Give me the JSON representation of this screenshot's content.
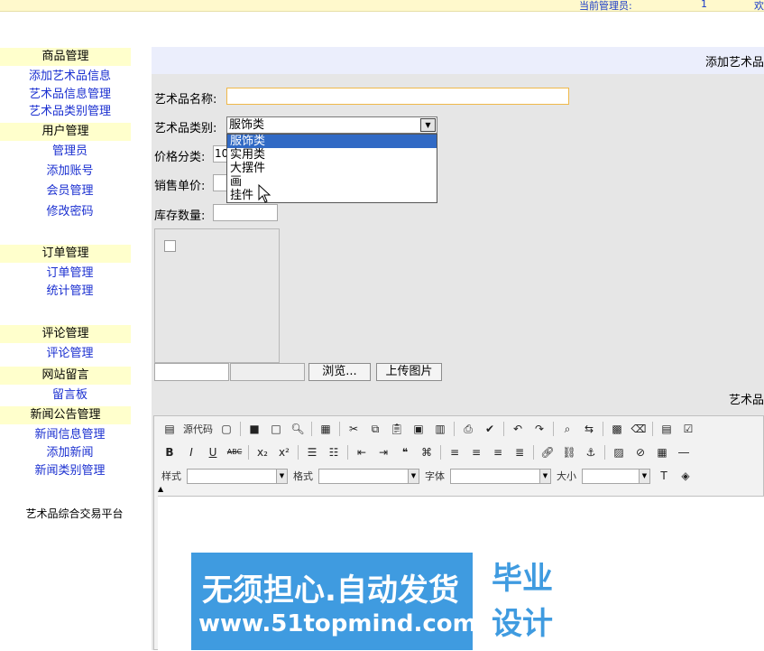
{
  "topbar": {
    "admin_label": "当前管理员:",
    "admin_count": "1",
    "tail": "欢"
  },
  "sidebar": {
    "sections": [
      {
        "title": "商品管理",
        "items": [
          "添加艺术品信息",
          "艺术品信息管理",
          "艺术品类别管理"
        ]
      },
      {
        "title": "用户管理",
        "items": [
          "管理员",
          "添加账号",
          "会员管理",
          "修改密码"
        ]
      },
      {
        "title": "订单管理",
        "items": [
          "订单管理",
          "统计管理"
        ]
      },
      {
        "title": "评论管理",
        "items": [
          "评论管理"
        ]
      },
      {
        "title": "网站留言",
        "items": [
          "留言板"
        ]
      },
      {
        "title": "新闻公告管理",
        "items": [
          "新闻信息管理",
          "添加新闻",
          "新闻类别管理"
        ]
      }
    ],
    "platform": "艺术品综合交易平台"
  },
  "main": {
    "title": "添加艺术品",
    "fields": {
      "name_label": "艺术品名称:",
      "category_label": "艺术品类别:",
      "category_value": "服饰类",
      "category_options": [
        "服饰类",
        "实用类",
        "大摆件",
        "画",
        "挂件"
      ],
      "price_cat_label": "价格分类:",
      "price_cat_value": "10",
      "unit_price_label": "销售单价:",
      "stock_label": "库存数量:"
    },
    "browse_button": "浏览...",
    "upload_button": "上传图片",
    "sub_label": "艺术品"
  },
  "editor": {
    "source_label": "源代码",
    "style_label": "样式",
    "format_label": "格式",
    "font_label": "字体",
    "size_label": "大小"
  },
  "watermark": {
    "line1": "无须担心.自动发货",
    "line2": "www.51topmind.com",
    "box_line1": "毕业",
    "box_line2": "设计"
  }
}
